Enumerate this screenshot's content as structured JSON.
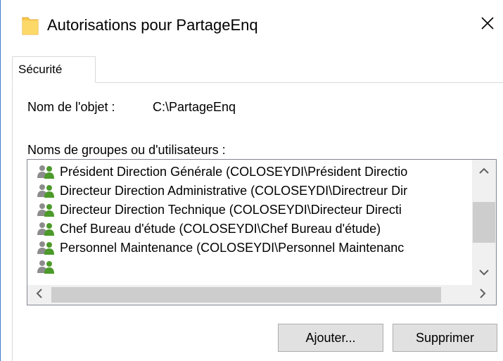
{
  "window": {
    "title": "Autorisations pour PartageEnq",
    "icon": "folder-icon",
    "close_glyph": "✕",
    "border_color": "#3c7ec8"
  },
  "tabs": [
    {
      "label": "Sécurité",
      "selected": true
    }
  ],
  "object": {
    "label": "Nom de l'objet :",
    "value": "C:\\PartageEnq"
  },
  "groups": {
    "label": "Noms de groupes ou d'utilisateurs :",
    "items": [
      {
        "label": "Président Direction Générale (COLOSEYDI\\Président Directio",
        "icon": "users-group-icon"
      },
      {
        "label": "Directeur Direction Administrative (COLOSEYDI\\Directreur Dir",
        "icon": "users-group-icon"
      },
      {
        "label": "Directeur Direction Technique (COLOSEYDI\\Directeur Directi",
        "icon": "users-group-icon"
      },
      {
        "label": "Chef Bureau d'étude (COLOSEYDI\\Chef Bureau d'étude)",
        "icon": "users-group-icon"
      },
      {
        "label": "Personnel Maintenance (COLOSEYDI\\Personnel Maintenanc",
        "icon": "users-group-icon"
      }
    ]
  },
  "buttons": {
    "add": "Ajouter...",
    "remove": "Supprimer"
  },
  "colors": {
    "folder": "#f7c948",
    "user_green": "#4c9a2a",
    "user_gray": "#8c8c8c",
    "button_bg": "#e1e1e1",
    "scroll_thumb": "#cdcdcd"
  }
}
